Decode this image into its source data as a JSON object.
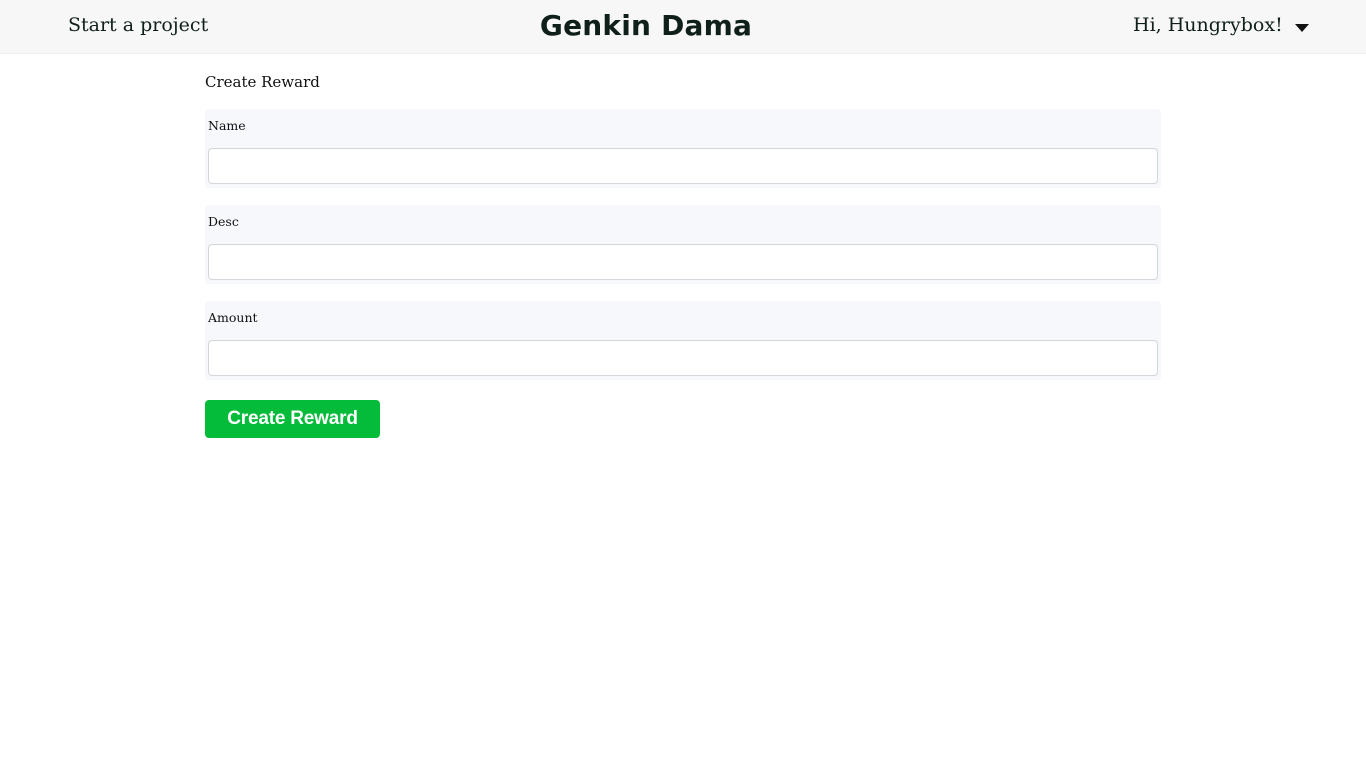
{
  "navbar": {
    "start_project_label": "Start a project",
    "brand": "Genkin Dama",
    "user_greeting": "Hi, Hungrybox!",
    "user_menu_icon": "caret-down-icon"
  },
  "form": {
    "title": "Create Reward",
    "fields": [
      {
        "label": "Name",
        "value": "",
        "placeholder": ""
      },
      {
        "label": "Desc",
        "value": "",
        "placeholder": ""
      },
      {
        "label": "Amount",
        "value": "",
        "placeholder": ""
      }
    ],
    "submit_label": "Create Reward"
  },
  "colors": {
    "navbar_bg": "#f7f7f7",
    "brand_text": "#0f1f1a",
    "field_group_bg": "#f7f8fb",
    "submit_bg": "#05bb3a",
    "submit_text": "#ffffff"
  }
}
